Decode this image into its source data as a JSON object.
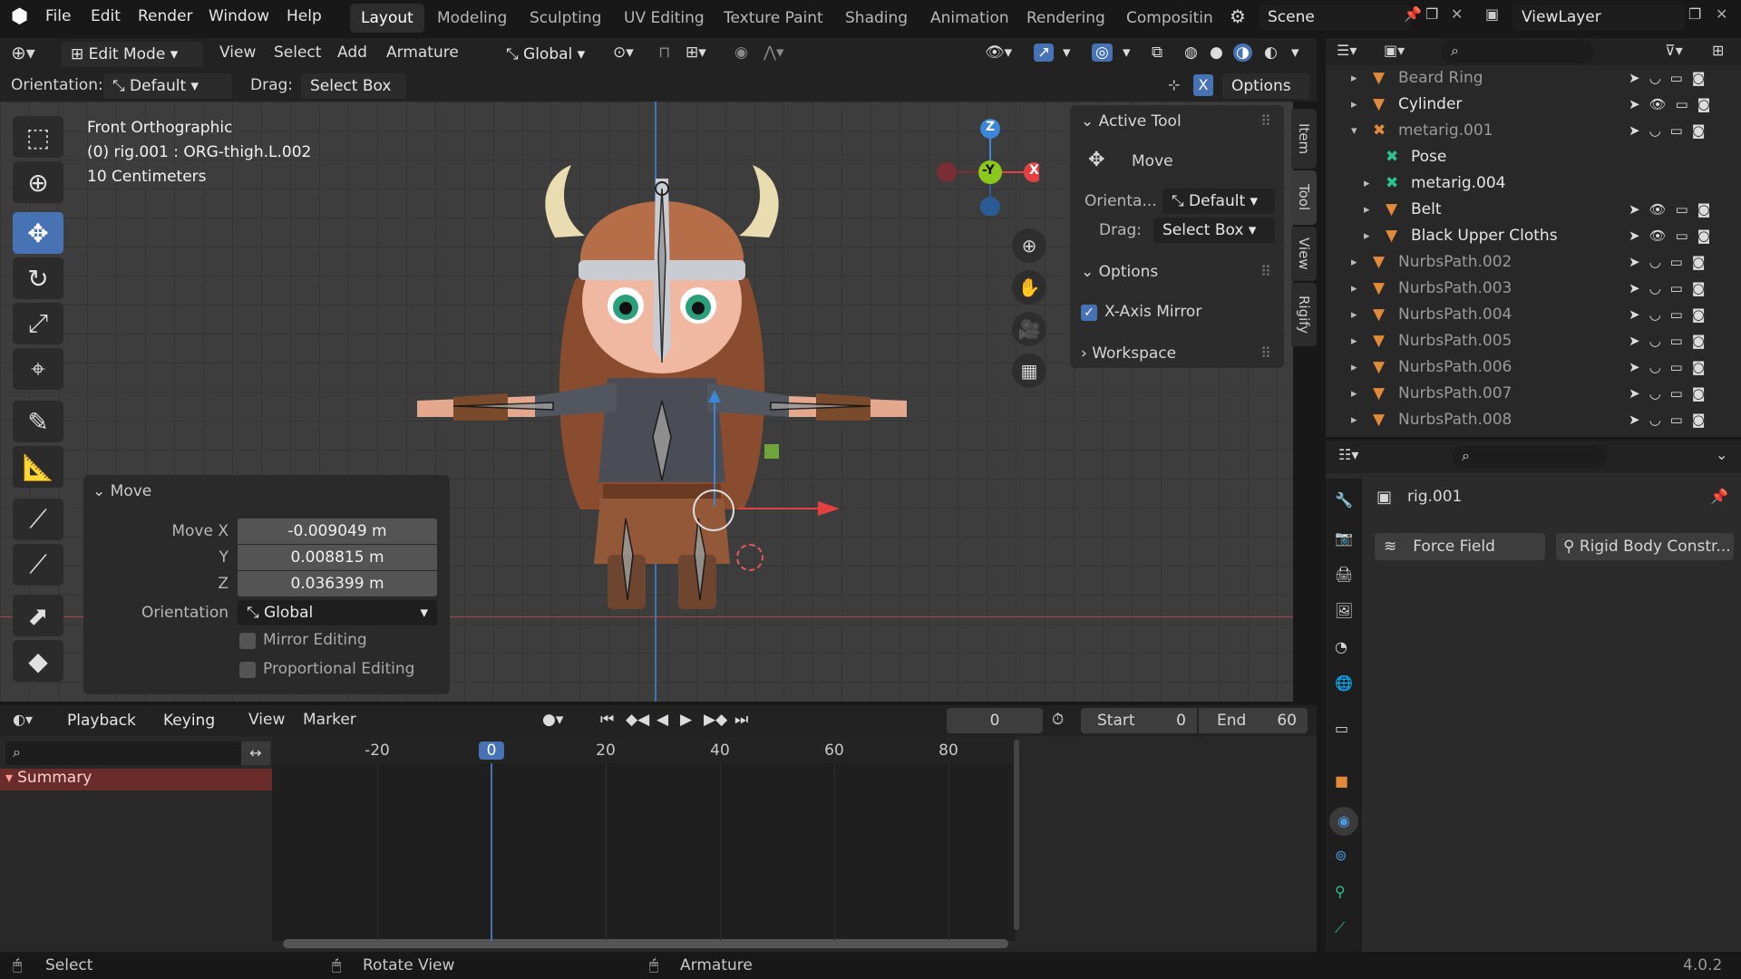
{
  "app": {
    "version": "4.0.2"
  },
  "menu": [
    "File",
    "Edit",
    "Render",
    "Window",
    "Help"
  ],
  "workspaces": [
    "Layout",
    "Modeling",
    "Sculpting",
    "UV Editing",
    "Texture Paint",
    "Shading",
    "Animation",
    "Rendering",
    "Compositin"
  ],
  "active_workspace": "Layout",
  "scene": "Scene",
  "view_layer": "ViewLayer",
  "viewport_header": {
    "mode": "Edit Mode",
    "menus": [
      "View",
      "Select",
      "Add",
      "Armature"
    ],
    "transform_orientation": "Global"
  },
  "tool_settings": {
    "orientation_label": "Orientation:",
    "orientation_value": "Default",
    "drag_label": "Drag:",
    "drag_value": "Select Box",
    "x_badge": "X",
    "options_label": "Options"
  },
  "viewport_info": {
    "view": "Front Orthographic",
    "object": "(0) rig.001 : ORG-thigh.L.002",
    "scale": "10 Centimeters"
  },
  "gizmo": {
    "z": "Z",
    "y": "-Y",
    "x": "X"
  },
  "n_panel": {
    "active_tool_title": "Active Tool",
    "tool_name": "Move",
    "orientation_label": "Orienta...",
    "orientation_value": "Default",
    "drag_label": "Drag:",
    "drag_value": "Select Box",
    "options_title": "Options",
    "x_mirror": "X-Axis Mirror",
    "workspace_title": "Workspace",
    "tabs": [
      "Item",
      "Tool",
      "View",
      "Rigify"
    ]
  },
  "last_operator": {
    "title": "Move",
    "move_x_label": "Move X",
    "move_x": "-0.009049 m",
    "y_label": "Y",
    "y": "0.008815 m",
    "z_label": "Z",
    "z": "0.036399 m",
    "orientation_label": "Orientation",
    "orientation_value": "Global",
    "mirror": "Mirror Editing",
    "proportional": "Proportional Editing"
  },
  "outliner": {
    "items": [
      {
        "name": "Beard Ring",
        "dim": true
      },
      {
        "name": "Cylinder",
        "dim": false
      },
      {
        "name": "metarig.001",
        "dim": true
      },
      {
        "name": "Pose",
        "dim": false
      },
      {
        "name": "metarig.004",
        "dim": false
      },
      {
        "name": "Belt",
        "dim": false
      },
      {
        "name": "Black Upper Cloths",
        "dim": false
      },
      {
        "name": "NurbsPath.002",
        "dim": true
      },
      {
        "name": "NurbsPath.003",
        "dim": true
      },
      {
        "name": "NurbsPath.004",
        "dim": true
      },
      {
        "name": "NurbsPath.005",
        "dim": true
      },
      {
        "name": "NurbsPath.006",
        "dim": true
      },
      {
        "name": "NurbsPath.007",
        "dim": true
      },
      {
        "name": "NurbsPath.008",
        "dim": true
      }
    ]
  },
  "properties": {
    "object_name": "rig.001",
    "force_field": "Force Field",
    "rigid_body": "Rigid Body Constr..."
  },
  "timeline": {
    "menus": [
      "Playback",
      "Keying",
      "View",
      "Marker"
    ],
    "current_frame": "0",
    "start_label": "Start",
    "start": "0",
    "end_label": "End",
    "end": "60",
    "ruler": [
      "-20",
      "0",
      "20",
      "40",
      "60",
      "80"
    ],
    "summary": "Summary"
  },
  "statusbar": {
    "select": "Select",
    "rotate": "Rotate View",
    "armature": "Armature"
  },
  "colors": {
    "accent": "#4772b3",
    "x_axis": "#e34040",
    "y_axis": "#8cc81c",
    "z_axis": "#3b86d6"
  }
}
